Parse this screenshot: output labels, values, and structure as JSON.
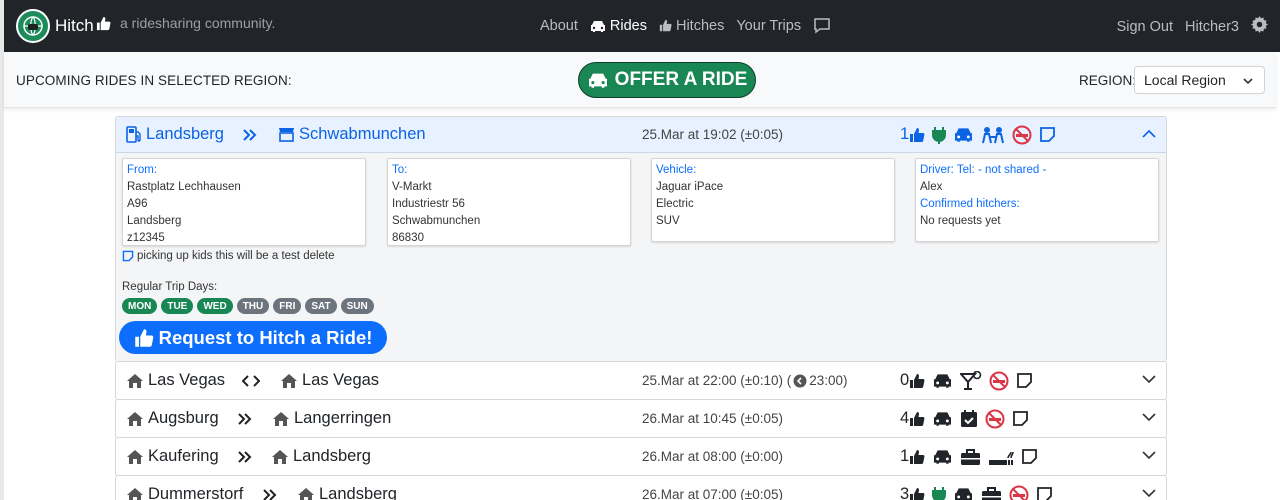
{
  "brand": {
    "name": "Hitch",
    "tagline": "a ridesharing community."
  },
  "nav": {
    "items": [
      {
        "label": "About",
        "icon": ""
      },
      {
        "label": "Rides",
        "icon": "car-icon",
        "active": true
      },
      {
        "label": "Hitches",
        "icon": "thumbs-up-icon"
      },
      {
        "label": "Your Trips",
        "icon": ""
      }
    ],
    "sign_out": "Sign Out",
    "user": "Hitcher3"
  },
  "subheader": {
    "title": "UPCOMING RIDES IN SELECTED REGION:",
    "offer_button": "OFFER A RIDE",
    "region_label": "REGION:",
    "region_value": "Local Region"
  },
  "rides": [
    {
      "from": "Landsberg",
      "to": "Schwabmunchen",
      "when": "25.Mar at 19:02 (±0:05)",
      "likes": "1",
      "open": true,
      "details": {
        "from_title": "From:",
        "from_lines": [
          "Rastplatz Lechhausen",
          "A96",
          "Landsberg",
          "z12345"
        ],
        "to_title": "To:",
        "to_lines": [
          "V-Markt",
          "Industriestr 56",
          "Schwabmunchen",
          "86830"
        ],
        "vehicle_title": "Vehicle:",
        "vehicle_lines": [
          "Jaguar iPace",
          "Electric",
          "SUV"
        ],
        "driver_title": "Driver: Tel: - not shared -",
        "driver_name": "Alex",
        "hitchers_title": "Confirmed hitchers:",
        "hitchers_value": "No requests yet",
        "note": "picking up kids this will be a test delete",
        "days_label": "Regular Trip Days:",
        "days": [
          {
            "label": "MON",
            "on": true
          },
          {
            "label": "TUE",
            "on": true
          },
          {
            "label": "WED",
            "on": true
          },
          {
            "label": "THU",
            "on": false
          },
          {
            "label": "FRI",
            "on": false
          },
          {
            "label": "SAT",
            "on": false
          },
          {
            "label": "SUN",
            "on": false
          }
        ],
        "request_button": "Request to Hitch a Ride!"
      }
    },
    {
      "from": "Las Vegas",
      "to": "Las Vegas",
      "when": "25.Mar at 22:00 (±0:10) (",
      "return_time": "23:00)",
      "likes": "0",
      "arrow": "<>"
    },
    {
      "from": "Augsburg",
      "to": "Langerringen",
      "when": "26.Mar at 10:45 (±0:05)",
      "likes": "4",
      "arrow": ">>"
    },
    {
      "from": "Kaufering",
      "to": "Landsberg",
      "when": "26.Mar at 08:00 (±0:00)",
      "likes": "1",
      "arrow": ">>"
    },
    {
      "from": "Dummerstorf",
      "to": "Landsberg",
      "when": "26.Mar at 07:00 (±0:05)",
      "likes": "3",
      "arrow": ">>"
    }
  ],
  "colors": {
    "navbar": "#212529",
    "accent": "#0d6efd",
    "green": "#198754",
    "red": "#dc3545"
  }
}
